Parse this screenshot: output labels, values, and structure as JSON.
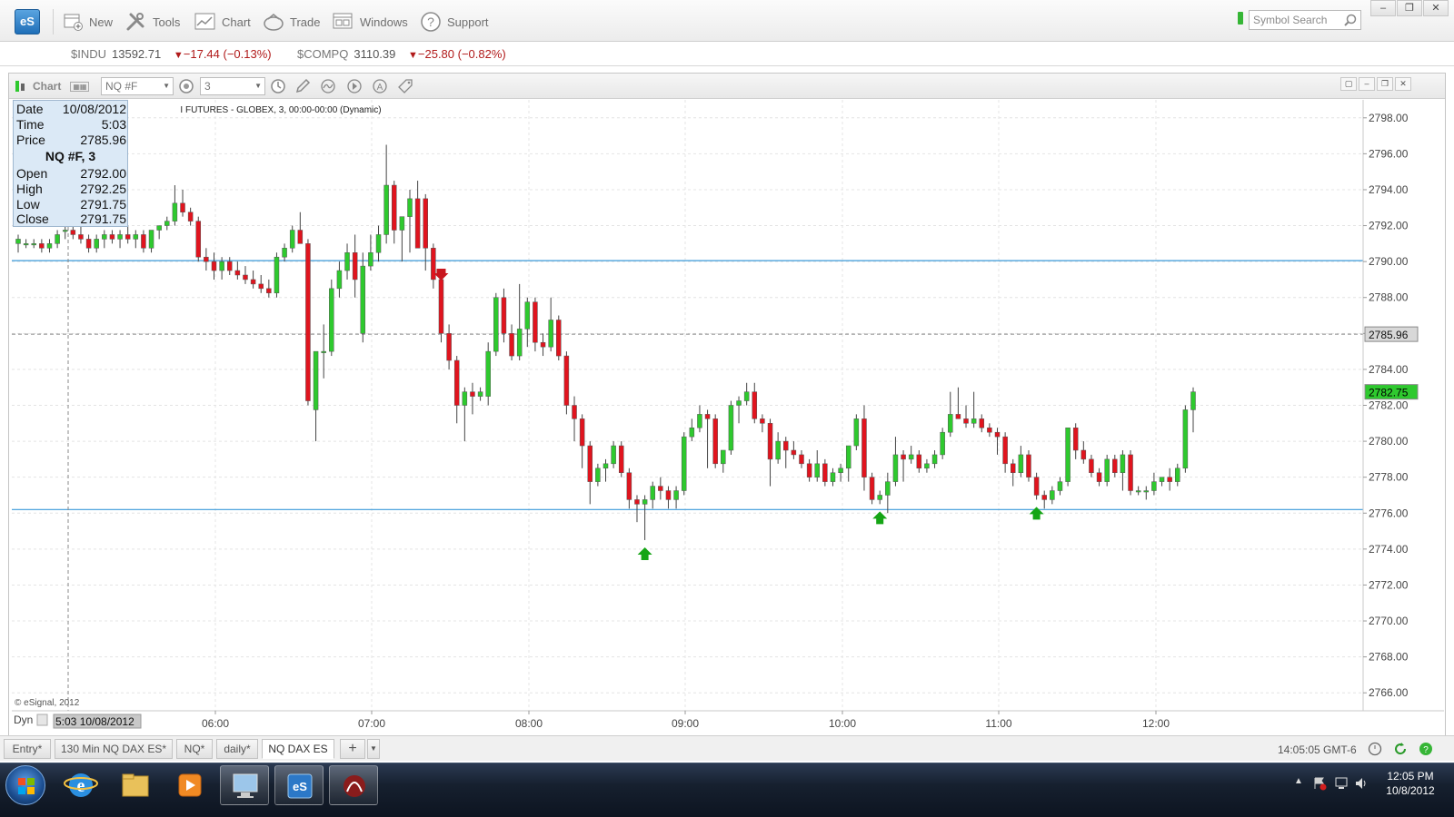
{
  "toolbar": {
    "logo": "eS",
    "buttons": [
      {
        "label": "New",
        "icon": "new-chart-icon"
      },
      {
        "label": "Tools",
        "icon": "tools-icon"
      },
      {
        "label": "Chart",
        "icon": "chart-icon"
      },
      {
        "label": "Trade",
        "icon": "trade-icon"
      },
      {
        "label": "Windows",
        "icon": "windows-icon"
      },
      {
        "label": "Support",
        "icon": "help-icon"
      }
    ],
    "symbol_search_placeholder": "Symbol Search"
  },
  "quotes": [
    {
      "symbol": "$INDU",
      "price": "13592.71",
      "change": "−17.44 (−0.13%)"
    },
    {
      "symbol": "$COMPQ",
      "price": "3110.39",
      "change": "−25.80 (−0.82%)"
    }
  ],
  "chart_toolbar": {
    "title": "Chart",
    "symbol": "NQ #F",
    "interval": "3"
  },
  "chart_header": "I FUTURES - GLOBEX, 3, 00:00-00:00 (Dynamic)",
  "data_window": {
    "rows_top": [
      {
        "label": "Date",
        "value": "10/08/2012"
      },
      {
        "label": "Time",
        "value": "5:03"
      },
      {
        "label": "Price",
        "value": "2785.96"
      }
    ],
    "title": "NQ #F, 3",
    "rows_bottom": [
      {
        "label": "Open",
        "value": "2792.00"
      },
      {
        "label": "High",
        "value": "2792.25"
      },
      {
        "label": "Low",
        "value": "2791.75"
      },
      {
        "label": "Close",
        "value": "2791.75"
      }
    ]
  },
  "copyright": "© eSignal, 2012",
  "cursor_label": "Dyn",
  "cursor_time": "5:03 10/08/2012",
  "tabs": [
    "Entry*",
    "130 Min NQ DAX ES*",
    "NQ*",
    "daily*",
    "NQ DAX ES"
  ],
  "active_tab": "NQ DAX ES",
  "status_clock": "14:05:05 GMT-6",
  "tray": {
    "time": "12:05 PM",
    "date": "10/8/2012"
  },
  "colors": {
    "up": "#2ec92e",
    "down": "#e0141e",
    "hline": "#3a9ad9",
    "accent": "#1f6fb8"
  },
  "chart_data": {
    "type": "candlestick",
    "title": "NQ #F, 3",
    "ylim": [
      2765,
      2799
    ],
    "yticks": [
      "2798.00",
      "2796.00",
      "2794.00",
      "2792.00",
      "2790.00",
      "2788.00",
      "2786.00",
      "2784.00",
      "2782.00",
      "2780.00",
      "2778.00",
      "2776.00",
      "2774.00",
      "2772.00",
      "2770.00",
      "2768.00",
      "2766.00"
    ],
    "xticks": [
      "06:00",
      "07:00",
      "08:00",
      "09:00",
      "10:00",
      "11:00",
      "12:00"
    ],
    "current_price_label": "2785.96",
    "last_price_label": "2782.75",
    "horizontal_lines": [
      2790.05,
      2776.2
    ],
    "crosshair_price": 2785.96,
    "arrows": [
      {
        "type": "down",
        "bar": 54
      },
      {
        "type": "up",
        "bar": 80
      },
      {
        "type": "up",
        "bar": 110
      },
      {
        "type": "up",
        "bar": 130
      }
    ],
    "candles": [
      [
        2791.0,
        2791.5,
        2790.5,
        2791.25
      ],
      [
        2791.0,
        2791.25,
        2790.75,
        2791.0
      ],
      [
        2791.0,
        2791.25,
        2790.75,
        2791.0
      ],
      [
        2791.0,
        2791.25,
        2790.5,
        2790.75
      ],
      [
        2790.75,
        2791.25,
        2790.5,
        2791.0
      ],
      [
        2791.0,
        2791.75,
        2790.75,
        2791.5
      ],
      [
        2791.75,
        2792.25,
        2791.25,
        2791.75
      ],
      [
        2791.75,
        2792.25,
        2791.25,
        2791.5
      ],
      [
        2791.5,
        2792.0,
        2791.0,
        2791.25
      ],
      [
        2791.25,
        2791.5,
        2790.5,
        2790.75
      ],
      [
        2790.75,
        2791.5,
        2790.5,
        2791.25
      ],
      [
        2791.25,
        2791.75,
        2790.75,
        2791.5
      ],
      [
        2791.5,
        2791.75,
        2791.0,
        2791.25
      ],
      [
        2791.25,
        2791.75,
        2790.75,
        2791.5
      ],
      [
        2791.5,
        2792.0,
        2791.0,
        2791.25
      ],
      [
        2791.25,
        2791.75,
        2790.75,
        2791.5
      ],
      [
        2791.5,
        2791.75,
        2790.5,
        2790.75
      ],
      [
        2790.75,
        2791.5,
        2790.5,
        2791.75
      ],
      [
        2791.75,
        2792.0,
        2791.25,
        2792.0
      ],
      [
        2792.0,
        2792.5,
        2791.75,
        2792.25
      ],
      [
        2792.25,
        2794.25,
        2792.0,
        2793.25
      ],
      [
        2793.25,
        2794.0,
        2792.5,
        2792.75
      ],
      [
        2792.75,
        2793.0,
        2792.0,
        2792.25
      ],
      [
        2792.25,
        2792.5,
        2790.0,
        2790.25
      ],
      [
        2790.25,
        2790.75,
        2789.5,
        2790.0
      ],
      [
        2790.0,
        2790.5,
        2789.0,
        2789.5
      ],
      [
        2789.5,
        2790.25,
        2789.0,
        2790.0
      ],
      [
        2790.0,
        2790.25,
        2789.25,
        2789.5
      ],
      [
        2789.5,
        2790.0,
        2789.0,
        2789.25
      ],
      [
        2789.25,
        2789.75,
        2788.75,
        2789.0
      ],
      [
        2789.0,
        2789.5,
        2788.5,
        2788.75
      ],
      [
        2788.75,
        2789.25,
        2788.25,
        2788.5
      ],
      [
        2788.5,
        2789.0,
        2788.0,
        2788.25
      ],
      [
        2788.25,
        2790.5,
        2788.0,
        2790.25
      ],
      [
        2790.25,
        2791.0,
        2790.0,
        2790.75
      ],
      [
        2790.75,
        2792.0,
        2790.5,
        2791.75
      ],
      [
        2791.75,
        2792.75,
        2791.0,
        2791.0
      ],
      [
        2791.0,
        2791.25,
        2782.0,
        2782.25
      ],
      [
        2781.75,
        2782.5,
        2780.0,
        2785.0
      ],
      [
        2785.0,
        2786.5,
        2783.5,
        2785.0
      ],
      [
        2785.0,
        2789.0,
        2784.75,
        2788.5
      ],
      [
        2788.5,
        2790.0,
        2788.0,
        2789.5
      ],
      [
        2789.5,
        2791.0,
        2789.0,
        2790.5
      ],
      [
        2790.5,
        2791.5,
        2788.0,
        2789.0
      ],
      [
        2786.0,
        2790.5,
        2785.5,
        2789.75
      ],
      [
        2789.75,
        2791.5,
        2789.5,
        2790.5
      ],
      [
        2790.5,
        2792.0,
        2790.0,
        2791.5
      ],
      [
        2791.5,
        2796.5,
        2791.0,
        2794.25
      ],
      [
        2794.25,
        2794.5,
        2791.0,
        2791.75
      ],
      [
        2791.75,
        2792.0,
        2790.0,
        2792.5
      ],
      [
        2792.5,
        2794.0,
        2790.5,
        2793.5
      ],
      [
        2793.5,
        2794.5,
        2792.5,
        2790.75
      ],
      [
        2793.5,
        2793.75,
        2789.5,
        2790.75
      ],
      [
        2790.75,
        2791.0,
        2788.5,
        2789.0
      ],
      [
        2789.0,
        2789.5,
        2785.5,
        2786.0
      ],
      [
        2786.0,
        2786.5,
        2784.0,
        2784.5
      ],
      [
        2784.5,
        2784.75,
        2781.0,
        2782.0
      ],
      [
        2782.0,
        2783.0,
        2780.0,
        2782.75
      ],
      [
        2782.75,
        2783.25,
        2781.5,
        2782.5
      ],
      [
        2782.5,
        2783.0,
        2782.25,
        2782.75
      ],
      [
        2782.5,
        2785.5,
        2782.0,
        2785.0
      ],
      [
        2785.0,
        2788.25,
        2784.75,
        2788.0
      ],
      [
        2788.0,
        2788.5,
        2785.5,
        2786.0
      ],
      [
        2786.0,
        2786.5,
        2784.5,
        2784.75
      ],
      [
        2784.75,
        2788.75,
        2784.5,
        2786.25
      ],
      [
        2786.25,
        2788.0,
        2785.25,
        2787.75
      ],
      [
        2787.75,
        2788.0,
        2785.0,
        2785.5
      ],
      [
        2785.5,
        2786.0,
        2784.75,
        2785.25
      ],
      [
        2785.25,
        2788.0,
        2785.0,
        2786.75
      ],
      [
        2786.75,
        2787.0,
        2784.5,
        2784.75
      ],
      [
        2784.75,
        2785.0,
        2781.5,
        2782.0
      ],
      [
        2782.0,
        2782.5,
        2780.0,
        2781.25
      ],
      [
        2781.25,
        2781.5,
        2778.5,
        2779.75
      ],
      [
        2779.75,
        2780.0,
        2776.5,
        2777.75
      ],
      [
        2777.75,
        2778.75,
        2777.5,
        2778.5
      ],
      [
        2778.5,
        2779.0,
        2777.75,
        2778.75
      ],
      [
        2778.75,
        2780.0,
        2778.5,
        2779.75
      ],
      [
        2779.75,
        2780.0,
        2778.0,
        2778.25
      ],
      [
        2778.25,
        2778.5,
        2776.25,
        2776.75
      ],
      [
        2776.75,
        2777.0,
        2775.5,
        2776.5
      ],
      [
        2776.5,
        2777.0,
        2774.5,
        2776.75
      ],
      [
        2776.75,
        2777.75,
        2776.25,
        2777.5
      ],
      [
        2777.5,
        2778.0,
        2776.75,
        2777.25
      ],
      [
        2777.25,
        2777.5,
        2776.25,
        2776.75
      ],
      [
        2776.75,
        2777.5,
        2776.25,
        2777.25
      ],
      [
        2777.25,
        2780.5,
        2777.0,
        2780.25
      ],
      [
        2780.25,
        2781.25,
        2780.0,
        2780.75
      ],
      [
        2780.75,
        2782.0,
        2780.5,
        2781.5
      ],
      [
        2781.5,
        2781.75,
        2778.5,
        2781.25
      ],
      [
        2781.25,
        2781.5,
        2778.5,
        2778.75
      ],
      [
        2778.75,
        2779.25,
        2778.25,
        2779.5
      ],
      [
        2779.5,
        2782.25,
        2779.25,
        2782.0
      ],
      [
        2782.0,
        2782.5,
        2781.0,
        2782.25
      ],
      [
        2782.25,
        2783.25,
        2782.0,
        2782.75
      ],
      [
        2782.75,
        2783.25,
        2781.0,
        2781.25
      ],
      [
        2781.25,
        2781.5,
        2780.5,
        2781.0
      ],
      [
        2781.0,
        2781.25,
        2777.5,
        2779.0
      ],
      [
        2779.0,
        2780.5,
        2778.75,
        2780.0
      ],
      [
        2780.0,
        2780.25,
        2778.5,
        2779.5
      ],
      [
        2779.5,
        2780.0,
        2779.0,
        2779.25
      ],
      [
        2779.25,
        2779.5,
        2778.5,
        2778.75
      ],
      [
        2778.75,
        2779.0,
        2777.75,
        2778.0
      ],
      [
        2778.0,
        2779.5,
        2777.75,
        2778.75
      ],
      [
        2778.75,
        2779.0,
        2777.5,
        2777.75
      ],
      [
        2777.75,
        2778.5,
        2777.5,
        2778.25
      ],
      [
        2778.25,
        2778.75,
        2777.75,
        2778.5
      ],
      [
        2778.5,
        2779.0,
        2777.75,
        2779.75
      ],
      [
        2779.75,
        2781.5,
        2779.5,
        2781.25
      ],
      [
        2781.25,
        2782.0,
        2777.25,
        2778.0
      ],
      [
        2778.0,
        2778.25,
        2776.5,
        2776.75
      ],
      [
        2776.75,
        2777.25,
        2776.5,
        2777.0
      ],
      [
        2777.0,
        2778.25,
        2776.0,
        2777.75
      ],
      [
        2777.75,
        2780.25,
        2777.5,
        2779.25
      ],
      [
        2779.25,
        2779.5,
        2777.75,
        2779.0
      ],
      [
        2779.0,
        2779.75,
        2778.75,
        2779.25
      ],
      [
        2779.25,
        2779.5,
        2778.25,
        2778.5
      ],
      [
        2778.5,
        2779.0,
        2778.25,
        2778.75
      ],
      [
        2778.75,
        2779.5,
        2778.5,
        2779.25
      ],
      [
        2779.25,
        2780.75,
        2779.0,
        2780.5
      ],
      [
        2780.5,
        2782.75,
        2780.25,
        2781.5
      ],
      [
        2781.5,
        2783.0,
        2781.25,
        2781.25
      ],
      [
        2781.25,
        2782.0,
        2780.75,
        2781.0
      ],
      [
        2781.0,
        2782.75,
        2780.75,
        2781.25
      ],
      [
        2781.25,
        2781.5,
        2780.5,
        2780.75
      ],
      [
        2780.75,
        2781.0,
        2780.25,
        2780.5
      ],
      [
        2780.5,
        2780.75,
        2779.25,
        2780.25
      ],
      [
        2780.25,
        2780.5,
        2778.25,
        2778.75
      ],
      [
        2778.75,
        2779.0,
        2777.5,
        2778.25
      ],
      [
        2778.25,
        2779.75,
        2778.0,
        2779.25
      ],
      [
        2779.25,
        2779.5,
        2777.75,
        2778.0
      ],
      [
        2778.0,
        2778.25,
        2776.75,
        2777.0
      ],
      [
        2777.0,
        2777.25,
        2776.25,
        2776.75
      ],
      [
        2776.75,
        2777.5,
        2776.5,
        2777.25
      ],
      [
        2777.25,
        2778.0,
        2777.0,
        2777.75
      ],
      [
        2777.75,
        2780.75,
        2777.5,
        2780.75
      ],
      [
        2780.75,
        2781.0,
        2779.0,
        2779.5
      ],
      [
        2779.5,
        2780.0,
        2778.75,
        2779.0
      ],
      [
        2779.0,
        2779.25,
        2778.0,
        2778.25
      ],
      [
        2778.25,
        2778.5,
        2777.5,
        2777.75
      ],
      [
        2777.75,
        2779.25,
        2777.5,
        2779.0
      ],
      [
        2779.0,
        2779.25,
        2778.0,
        2778.25
      ],
      [
        2778.25,
        2779.5,
        2777.25,
        2779.25
      ],
      [
        2779.25,
        2779.5,
        2777.0,
        2777.25
      ],
      [
        2777.25,
        2777.5,
        2777.0,
        2777.25
      ],
      [
        2777.25,
        2777.5,
        2776.75,
        2777.25
      ],
      [
        2777.25,
        2778.25,
        2777.0,
        2777.75
      ],
      [
        2777.75,
        2778.0,
        2777.5,
        2778.0
      ],
      [
        2778.0,
        2778.5,
        2777.25,
        2777.75
      ],
      [
        2777.75,
        2778.75,
        2777.5,
        2778.5
      ],
      [
        2778.5,
        2782.0,
        2778.25,
        2781.75
      ],
      [
        2781.75,
        2783.0,
        2780.5,
        2782.75
      ]
    ]
  }
}
